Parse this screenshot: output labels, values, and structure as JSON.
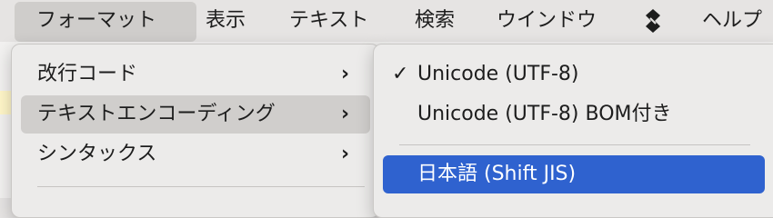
{
  "menubar": {
    "items": [
      {
        "label": "フォーマット"
      },
      {
        "label": "表示"
      },
      {
        "label": "テキスト"
      },
      {
        "label": "検索"
      },
      {
        "label": "ウインドウ"
      },
      {
        "label": "ヘルプ"
      }
    ],
    "app_icon": "script-app-icon"
  },
  "format_menu": {
    "items": [
      {
        "label": "改行コード"
      },
      {
        "label": "テキストエンコーディング"
      },
      {
        "label": "シンタックス"
      }
    ]
  },
  "encoding_submenu": {
    "items": [
      {
        "label": "Unicode (UTF-8)",
        "checked": true
      },
      {
        "label": "Unicode (UTF-8) BOM付き",
        "checked": false
      },
      {
        "label": "日本語 (Shift JIS)",
        "checked": false
      }
    ],
    "check_glyph": "✓"
  },
  "colors": {
    "selection_blue": "#2f62cf",
    "menubar_active": "#cfcdcb"
  }
}
